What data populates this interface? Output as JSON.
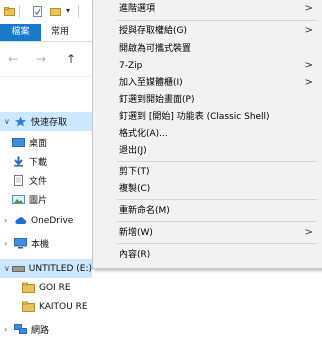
{
  "ribbon": {
    "tab_file": "檔案",
    "tab_home": "常用"
  },
  "nav": {
    "quick_access": "快速存取",
    "desktop": "桌面",
    "downloads": "下載",
    "documents": "文件",
    "pictures": "圖片",
    "onedrive": "OneDrive",
    "this_pc": "本機",
    "drive": "UNTITLED (E:)",
    "folder1": "GOI RE",
    "folder2": "KAITOU RE",
    "network": "網路"
  },
  "menu": {
    "items": [
      {
        "label": "進階選項",
        "submenu": true
      },
      {
        "label": "授與存取權給(G)",
        "submenu": true
      },
      {
        "label": "開啟為可攜式裝置",
        "submenu": false
      },
      {
        "label": "7-Zip",
        "submenu": true
      },
      {
        "label": "加入至媒體櫃(I)",
        "submenu": true
      },
      {
        "label": "釘選到開始畫面(P)",
        "submenu": false
      },
      {
        "label": "釘選到 [開始] 功能表 (Classic Shell)",
        "submenu": false
      },
      {
        "label": "格式化(A)...",
        "submenu": false
      },
      {
        "label": "退出(J)",
        "submenu": false
      },
      {
        "label": "剪下(T)",
        "submenu": false
      },
      {
        "label": "複製(C)",
        "submenu": false
      },
      {
        "label": "重新命名(M)",
        "submenu": false
      },
      {
        "label": "新增(W)",
        "submenu": true
      },
      {
        "label": "內容(R)",
        "submenu": false
      }
    ],
    "submenu_arrow": ">"
  },
  "colors": {
    "accent": "#1979ca",
    "menu_bg": "#f2f2f2",
    "selected_nav": "#cce8ff",
    "folder": "#e8c15a"
  }
}
